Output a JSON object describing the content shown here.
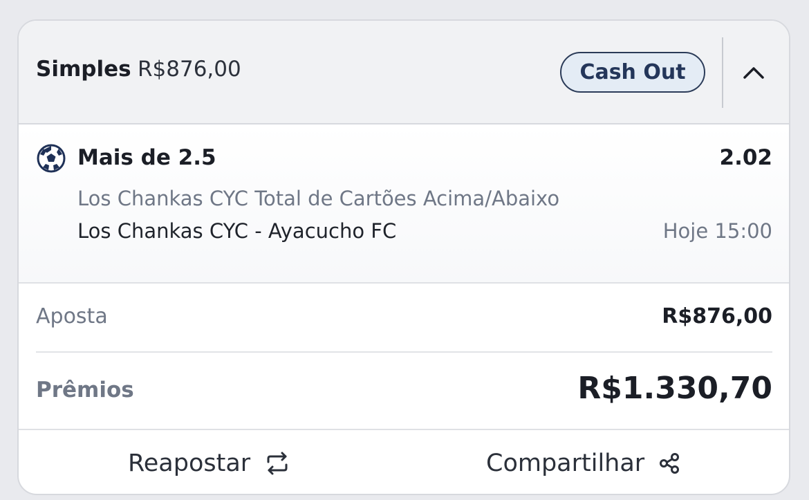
{
  "header": {
    "bet_type": "Simples",
    "stake_amount": "R$876,00",
    "cashout_label": "Cash Out",
    "collapse_icon": "chevron-up-icon",
    "accent": "#24365a"
  },
  "selection": {
    "sport_icon": "soccer-ball-icon",
    "title": "Mais de 2.5",
    "odds": "2.02",
    "market": "Los Chankas CYC Total de Cartões Acima/Abaixo",
    "event": "Los Chankas CYC - Ayacucho FC",
    "time": "Hoje 15:00"
  },
  "summary": {
    "stake_label": "Aposta",
    "stake_value": "R$876,00",
    "prize_label": "Prêmios",
    "prize_value": "R$1.330,70"
  },
  "footer": {
    "rebet_label": "Reapostar",
    "rebet_icon": "repeat-icon",
    "share_label": "Compartilhar",
    "share_icon": "share-icon"
  }
}
